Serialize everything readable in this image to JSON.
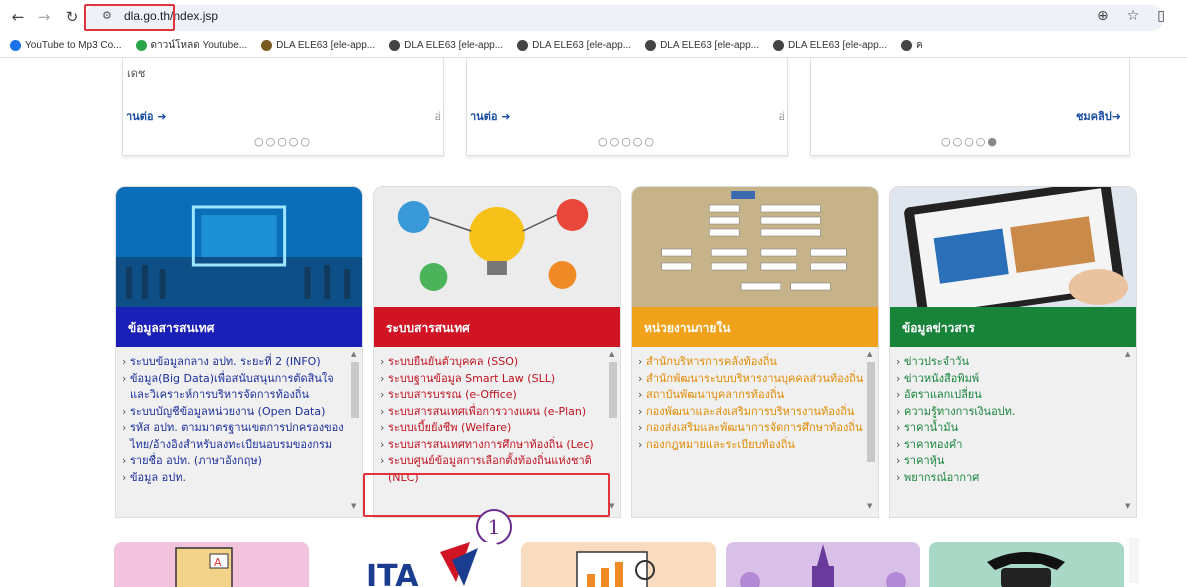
{
  "browser": {
    "url": "dla.go.th/index.jsp",
    "url_display": "dla.go.th/",
    "url_display_rest": "ndex.jsp",
    "icons": [
      "back-icon",
      "forward-icon",
      "reload-icon",
      "site-info-icon",
      "zoom-icon",
      "bookmark-star-icon"
    ]
  },
  "bookmarks": [
    {
      "label": "YouTube to Mp3 Co...",
      "color": "#1a73e8"
    },
    {
      "label": "ดาวน์โหลด Youtube...",
      "color": "#2aa54b"
    },
    {
      "label": "DLA ELE63 [ele-app...",
      "color": "#7a5a1e"
    },
    {
      "label": "DLA ELE63 [ele-app...",
      "color": "#444"
    },
    {
      "label": "DLA ELE63 [ele-app...",
      "color": "#444"
    },
    {
      "label": "DLA ELE63 [ele-app...",
      "color": "#444"
    },
    {
      "label": "DLA ELE63 [ele-app...",
      "color": "#444"
    },
    {
      "label": "ค",
      "color": "#444"
    }
  ],
  "cards": [
    {
      "text": "เดช",
      "readmore": "านต่อ",
      "extra": "อ่",
      "dots": "○○○○○"
    },
    {
      "text": "",
      "readmore": "านต่อ",
      "extra": "อ่",
      "dots": "○○○○○"
    },
    {
      "text": "",
      "readmore": "ชมคลิป",
      "extra": "",
      "dots": "○○○○●"
    }
  ],
  "panels": [
    {
      "title": "ข้อมูลสารสนเทศ",
      "header_color": "#1a1fb8",
      "link_color": "#1b2f9a",
      "items": [
        "ระบบข้อมูลกลาง อปท. ระยะที่ 2 (INFO)",
        "ข้อมูล(Big Data)เพื่อสนับสนุนการตัดสินใจและวิเคราะห์การบริหารจัดการท้องถิ่น",
        "ระบบบัญชีข้อมูลหน่วยงาน (Open Data)",
        "รหัส อปท. ตามมาตรฐานเขตการปกครองของไทย/อ้างอิงสำหรับลงทะเบียนอบรมของกรม",
        "รายชื่อ อปท. (ภาษาอังกฤษ)",
        "ข้อมูล อปท."
      ]
    },
    {
      "title": "ระบบสารสนเทศ",
      "header_color": "#d01424",
      "link_color": "#c0121f",
      "items": [
        "ระบบยืนยันตัวบุคคล (SSO)",
        "ระบบฐานข้อมูล Smart Law (SLL)",
        "ระบบสารบรรณ (e-Office)",
        "ระบบสารสนเทศเพื่อการวางแผน (e-Plan)",
        "ระบบเบี้ยยังชีพ (Welfare)",
        "ระบบสารสนเทศทางการศึกษาท้องถิ่น (Lec)",
        "ระบบศูนย์ข้อมูลการเลือกตั้งท้องถิ่นแห่งชาติ (NLC)"
      ]
    },
    {
      "title": "หน่วยงานภายใน",
      "header_color": "#f0a21a",
      "link_color": "#e08a00",
      "items": [
        "สำนักบริหารการคลังท้องถิ่น",
        "สำนักพัฒนาระบบบริหารงานบุคคลส่วนท้องถิ่น",
        "สถาบันพัฒนาบุคลากรท้องถิ่น",
        "กองพัฒนาและส่งเสริมการบริหารงานท้องถิ่น",
        "กองส่งเสริมและพัฒนาการจัดการศึกษาท้องถิ่น",
        "กองกฎหมายและระเบียบท้องถิ่น"
      ]
    },
    {
      "title": "ข้อมูลข่าวสาร",
      "header_color": "#17843a",
      "link_color": "#17843a",
      "items": [
        "ข่าวประจำวัน",
        "ข่าวหนังสือพิมพ์",
        "อัตราแลกเปลี่ยน",
        "ความรู้ทางการเงินอปท.",
        "ราคาน้ำมัน",
        "ราคาทองคำ",
        "ราคาหุ้น",
        "พยากรณ์อากาศ"
      ]
    }
  ],
  "annotation": {
    "label": "1"
  },
  "tiles": [
    {
      "color": "#f3c2dc",
      "icon": "book-icon"
    },
    {
      "color": "#ffffff",
      "icon": "ita-logo-icon"
    },
    {
      "color": "#f9dcc0",
      "icon": "chart-icon"
    },
    {
      "color": "#d8c0e8",
      "icon": "temple-icon"
    },
    {
      "color": "#a9d8c6",
      "icon": "telephone-icon"
    }
  ]
}
